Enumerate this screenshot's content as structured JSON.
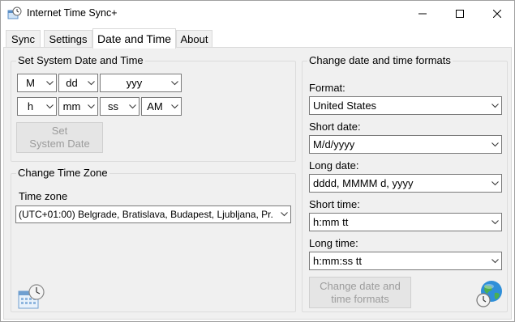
{
  "window": {
    "title": "Internet Time Sync+",
    "icon": "clock-sync-icon"
  },
  "tabs": [
    {
      "label": "Sync",
      "active": false
    },
    {
      "label": "Settings",
      "active": false
    },
    {
      "label": "Date and Time",
      "active": true
    },
    {
      "label": "About",
      "active": false
    }
  ],
  "set_date_time": {
    "title": "Set System Date and Time",
    "month": "M",
    "day": "dd",
    "year": "yyy",
    "hour": "h",
    "minute": "mm",
    "second": "ss",
    "ampm": "AM",
    "set_button": "Set\nSystem Date",
    "set_button_enabled": false
  },
  "time_zone": {
    "title": "Change Time Zone",
    "label": "Time zone",
    "value": "(UTC+01:00) Belgrade, Bratislava, Budapest, Ljubljana, Pr."
  },
  "formats": {
    "title": "Change date and time formats",
    "format_label": "Format:",
    "format_value": "United States",
    "short_date_label": "Short date:",
    "short_date_value": "M/d/yyyy",
    "long_date_label": "Long date:",
    "long_date_value": "dddd, MMMM d, yyyy",
    "short_time_label": "Short time:",
    "short_time_value": "h:mm tt",
    "long_time_label": "Long time:",
    "long_time_value": "h:mm:ss tt",
    "change_button": "Change date and\ntime formats",
    "change_button_enabled": false
  },
  "icons": {
    "calendar_clock": "calendar-clock-icon",
    "globe_clock": "globe-clock-icon"
  }
}
